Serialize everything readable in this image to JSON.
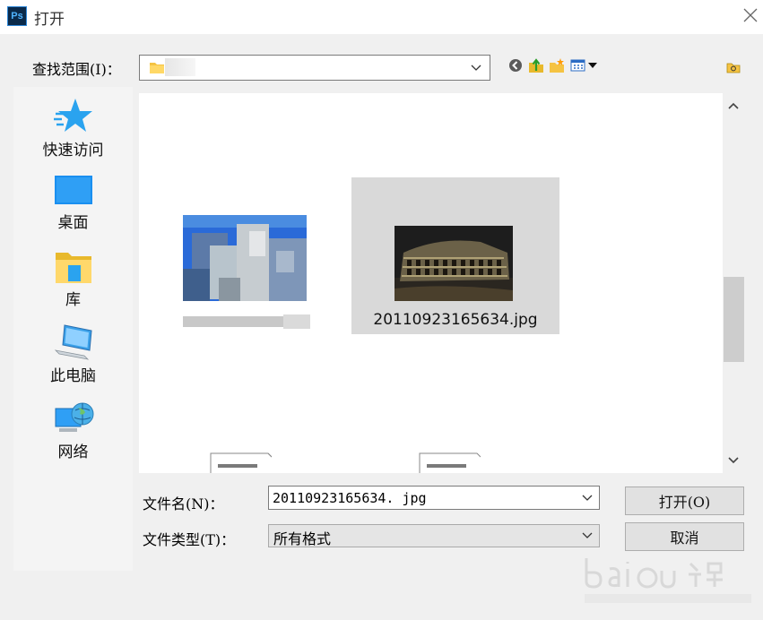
{
  "window": {
    "title": "打开",
    "app_icon_text": "Ps"
  },
  "look_in": {
    "label": "查找范围(I)：",
    "value": ""
  },
  "places": [
    {
      "label": "快速访问",
      "icon": "star-icon"
    },
    {
      "label": "桌面",
      "icon": "desktop-icon"
    },
    {
      "label": "库",
      "icon": "library-folder-icon"
    },
    {
      "label": "此电脑",
      "icon": "computer-icon"
    },
    {
      "label": "网络",
      "icon": "network-icon"
    }
  ],
  "files": [
    {
      "name": "",
      "selected": false,
      "blurred": true
    },
    {
      "name": "20110923165634.jpg",
      "selected": true,
      "blurred": false
    }
  ],
  "file_name": {
    "label": "文件名(N)：",
    "value": "20110923165634. jpg"
  },
  "file_type": {
    "label": "文件类型(T)：",
    "value": "所有格式"
  },
  "buttons": {
    "open": "打开(O)",
    "cancel": "取消"
  },
  "colors": {
    "selection": "#d9d9d9",
    "accent": "#1e90ff"
  }
}
